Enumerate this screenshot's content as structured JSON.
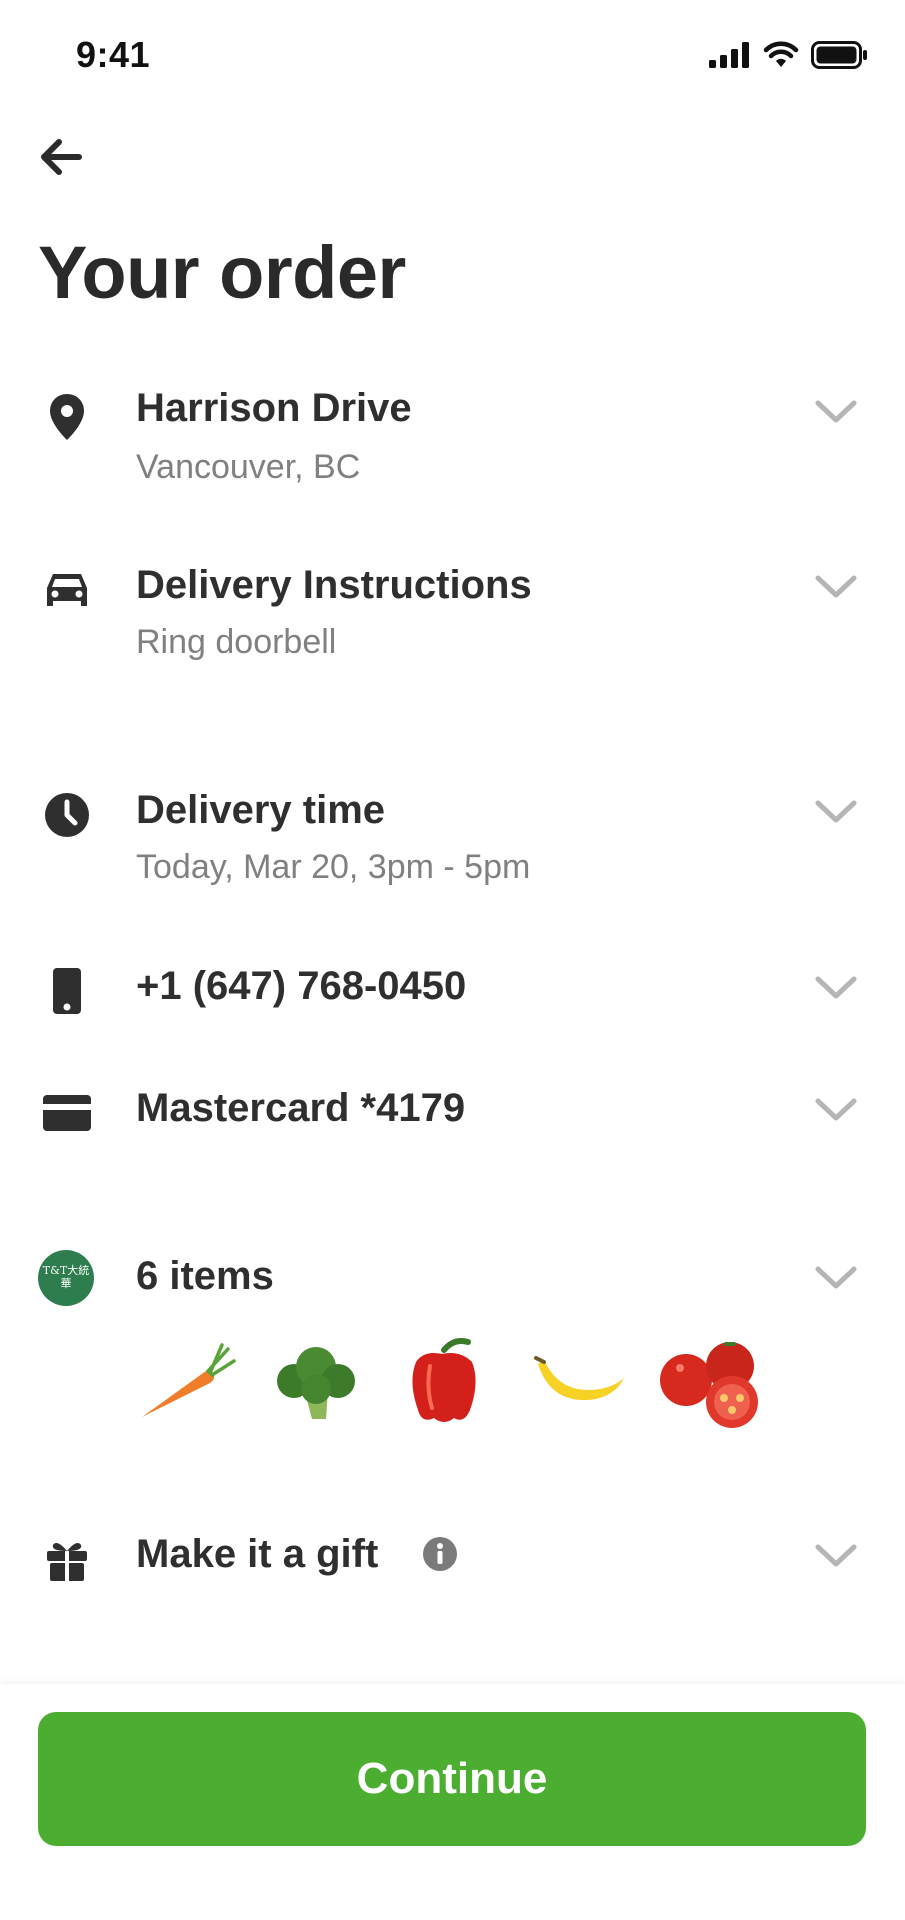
{
  "status_bar": {
    "time": "9:41"
  },
  "page": {
    "title": "Your order"
  },
  "address": {
    "label": "Harrison Drive",
    "sub": "Vancouver, BC"
  },
  "instructions": {
    "label": "Delivery Instructions",
    "sub": "Ring doorbell"
  },
  "delivery_time": {
    "label": "Delivery time",
    "sub": "Today, Mar 20, 3pm - 5pm"
  },
  "phone": {
    "label": "+1 (647) 768-0450"
  },
  "payment": {
    "label": "Mastercard *4179"
  },
  "items": {
    "label": "6 items",
    "store_logo_text": "T&T大統華",
    "thumbnails": [
      "carrot",
      "broccoli",
      "red-pepper",
      "banana",
      "tomatoes"
    ]
  },
  "gift": {
    "label": "Make it a gift"
  },
  "footer": {
    "continue_label": "Continue"
  },
  "colors": {
    "accent": "#4cae31",
    "text": "#2f2f2f",
    "subtext": "#808080",
    "chevron": "#b5b5b5",
    "logo": "#2e7d4f"
  },
  "icons": [
    "map-pin-icon",
    "car-icon",
    "clock-icon",
    "phone-icon",
    "credit-card-icon",
    "gift-icon",
    "info-icon",
    "chevron-down-icon",
    "back-arrow-icon"
  ]
}
